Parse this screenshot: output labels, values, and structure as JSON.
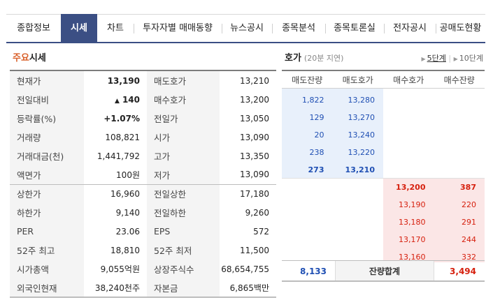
{
  "tabs": [
    {
      "label": "종합정보",
      "active": false
    },
    {
      "label": "시세",
      "active": true
    },
    {
      "label": "차트",
      "active": false
    },
    {
      "label": "투자자별 매매동향",
      "active": false
    },
    {
      "label": "뉴스공시",
      "active": false
    },
    {
      "label": "종목분석",
      "active": false
    },
    {
      "label": "종목토론실",
      "active": false
    },
    {
      "label": "전자공시",
      "active": false
    },
    {
      "label": "공매도현황",
      "active": false
    }
  ],
  "market": {
    "title_accent": "주요",
    "title_rest": "시세",
    "rows": [
      {
        "k1": "현재가",
        "v1": "13,190",
        "k2": "매도호가",
        "v2": "13,210"
      },
      {
        "k1": "전일대비",
        "v1": "140",
        "k2": "매수호가",
        "v2": "13,200"
      },
      {
        "k1": "등락률(%)",
        "v1": "+1.07%",
        "k2": "전일가",
        "v2": "13,050"
      },
      {
        "k1": "거래량",
        "v1": "108,821",
        "k2": "시가",
        "v2": "13,090"
      },
      {
        "k1": "거래대금(천)",
        "v1": "1,441,792",
        "k2": "고가",
        "v2": "13,350"
      },
      {
        "k1": "액면가",
        "v1": "100원",
        "k2": "저가",
        "v2": "13,090"
      },
      {
        "k1": "상한가",
        "v1": "16,960",
        "k2": "전일상한",
        "v2": "17,180"
      },
      {
        "k1": "하한가",
        "v1": "9,140",
        "k2": "전일하한",
        "v2": "9,260"
      },
      {
        "k1": "PER",
        "v1": "23.06",
        "k2": "EPS",
        "v2": "572"
      },
      {
        "k1": "52주 최고",
        "v1": "18,810",
        "k2": "52주 최저",
        "v2": "11,500"
      },
      {
        "k1": "시가총액",
        "v1": "9,055억원",
        "k2": "상장주식수",
        "v2": "68,654,755"
      },
      {
        "k1": "외국인현재",
        "v1": "38,240천주",
        "k2": "자본금",
        "v2": "6,865백만"
      }
    ],
    "change_icon": "up-triangle-icon"
  },
  "orderbook": {
    "title": "호가",
    "delay_note": "(20분 지연)",
    "levels": [
      "5단계",
      "10단계"
    ],
    "headers": [
      "매도잔량",
      "매도호가",
      "매수호가",
      "매수잔량"
    ],
    "asks": [
      {
        "qty": "1,822",
        "price": "13,280"
      },
      {
        "qty": "129",
        "price": "13,270"
      },
      {
        "qty": "20",
        "price": "13,240"
      },
      {
        "qty": "238",
        "price": "13,220"
      },
      {
        "qty": "273",
        "price": "13,210"
      }
    ],
    "bids": [
      {
        "price": "13,200",
        "qty": "387"
      },
      {
        "price": "13,190",
        "qty": "220"
      },
      {
        "price": "13,180",
        "qty": "291"
      },
      {
        "price": "13,170",
        "qty": "244"
      },
      {
        "price": "13,160",
        "qty": "332"
      }
    ],
    "total_label": "잔량합계",
    "total_ask": "8,133",
    "total_bid": "3,494"
  },
  "colors": {
    "up": "#d6200e",
    "ask": "#1f4fb3",
    "tab_active": "#3b4f84"
  }
}
